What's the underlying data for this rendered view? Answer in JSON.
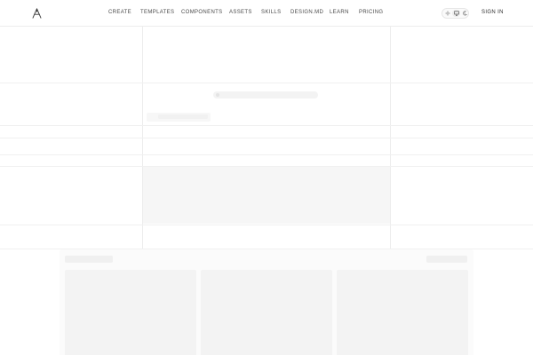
{
  "nav": {
    "logo_icon": "triangle-a-logo",
    "links": [
      {
        "label": "CREATE"
      },
      {
        "label": "TEMPLATES"
      },
      {
        "label": "COMPONENTS"
      },
      {
        "label": "ASSETS"
      },
      {
        "label": "SKILLS"
      },
      {
        "label": "DESIGN.MD"
      },
      {
        "label": "LEARN"
      },
      {
        "label": "PRICING"
      }
    ],
    "theme_options": [
      {
        "icon": "sun-icon",
        "active": false
      },
      {
        "icon": "monitor-icon",
        "active": true
      },
      {
        "icon": "moon-icon",
        "active": false
      }
    ],
    "sign_in_label": "SIGN IN"
  },
  "colors": {
    "background": "#ffffff",
    "grid_line": "#ececec",
    "skeleton": "#f3f3f3",
    "text": "#4a4a4a"
  }
}
